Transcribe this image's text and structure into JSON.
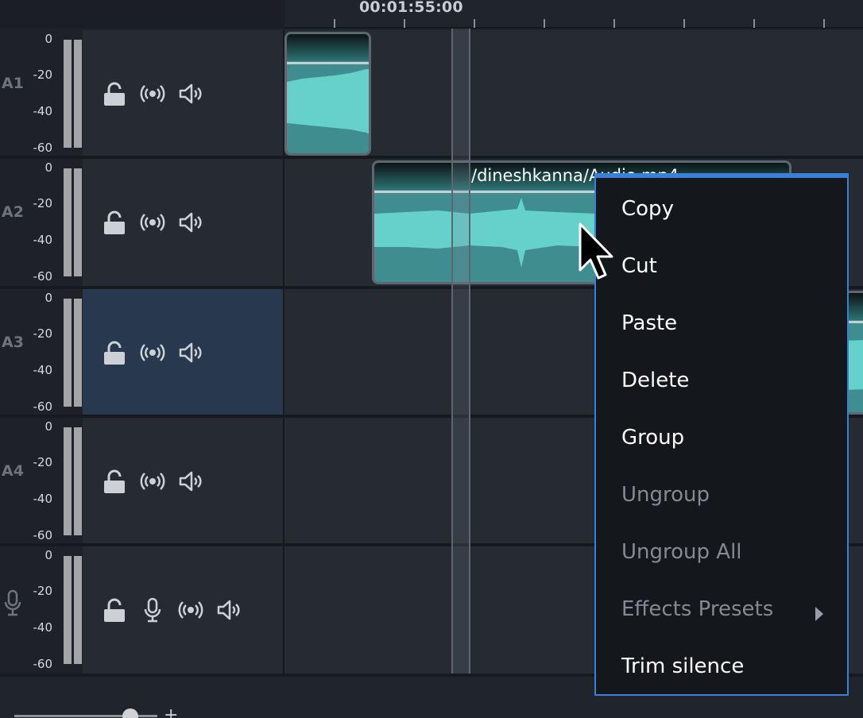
{
  "ruler": {
    "timecode": "00:01:55:00"
  },
  "meter_scale": [
    "0",
    "-20",
    "-40",
    "-60"
  ],
  "tracks": [
    {
      "name": "A1",
      "controls": [
        "lock-open-icon",
        "broadcast-icon",
        "speaker-icon"
      ],
      "selected": false
    },
    {
      "name": "A2",
      "controls": [
        "lock-open-icon",
        "broadcast-icon",
        "speaker-icon"
      ],
      "selected": false
    },
    {
      "name": "A3",
      "controls": [
        "lock-open-icon",
        "broadcast-icon",
        "speaker-icon"
      ],
      "selected": true
    },
    {
      "name": "A4",
      "controls": [
        "lock-open-icon",
        "broadcast-icon",
        "speaker-icon"
      ],
      "selected": false
    },
    {
      "name": "",
      "label_icon": "microphone-icon",
      "controls": [
        "lock-open-icon",
        "microphone-icon",
        "broadcast-icon",
        "speaker-icon"
      ],
      "selected": false
    }
  ],
  "clips": {
    "a2_title": "/dineshkanna/Audio.mp4"
  },
  "context_menu": {
    "items": [
      {
        "label": "Copy",
        "enabled": true
      },
      {
        "label": "Cut",
        "enabled": true
      },
      {
        "label": "Paste",
        "enabled": true
      },
      {
        "label": "Delete",
        "enabled": true
      },
      {
        "label": "Group",
        "enabled": true
      },
      {
        "label": "Ungroup",
        "enabled": false
      },
      {
        "label": "Ungroup All",
        "enabled": false
      },
      {
        "label": "Effects Presets",
        "enabled": false,
        "submenu": true
      },
      {
        "label": "Trim silence",
        "enabled": true
      }
    ]
  },
  "colors": {
    "accent": "#3a7fd8",
    "clip": "#3f8d8f",
    "waveform": "#66d1cb",
    "selected_track": "#28384e"
  }
}
